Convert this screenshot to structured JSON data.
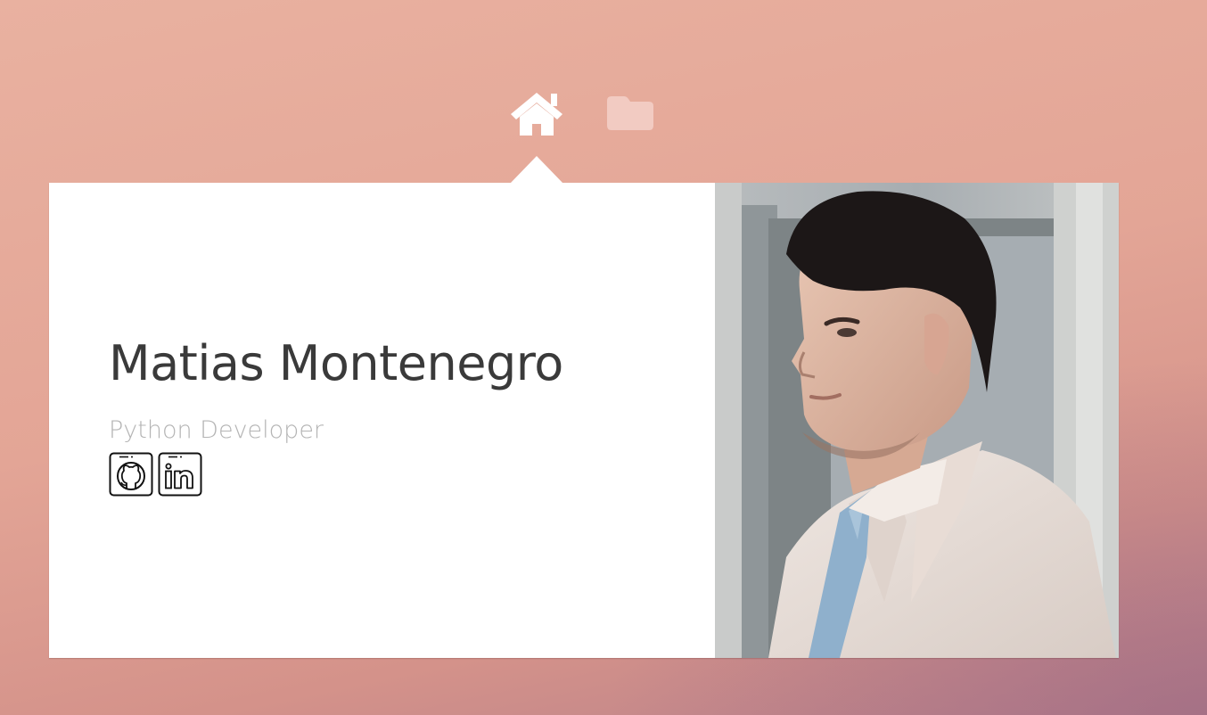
{
  "nav": {
    "items": [
      {
        "icon": "home-icon",
        "active": true
      },
      {
        "icon": "folder-icon",
        "active": false
      }
    ]
  },
  "profile": {
    "name": "Matias Montenegro",
    "role": "Python Developer",
    "socials": [
      {
        "icon": "github-icon"
      },
      {
        "icon": "linkedin-icon"
      }
    ]
  },
  "colors": {
    "background_top": "#e9b1a0",
    "background_bottom": "#b8808b",
    "card": "#ffffff",
    "name_text": "#3a3a3a",
    "role_text": "#b4b4b4",
    "nav_active": "#ffffff",
    "nav_inactive": "#f2cbc2"
  }
}
